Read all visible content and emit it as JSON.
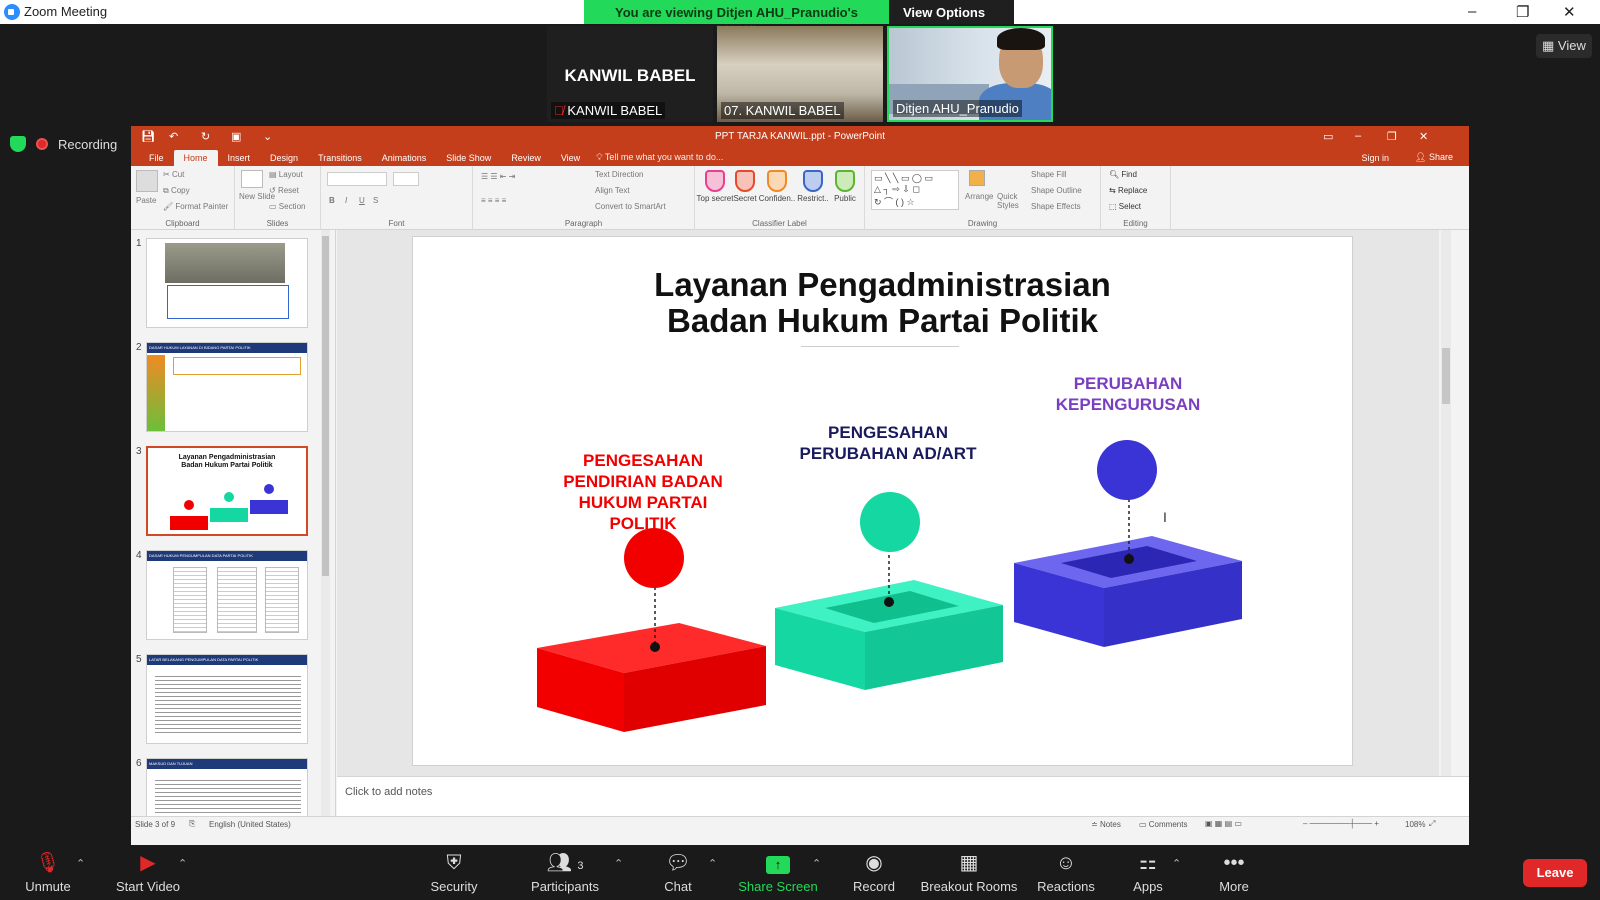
{
  "window": {
    "app_title": "Zoom Meeting",
    "controls": [
      "–",
      "❐",
      "✕"
    ]
  },
  "banner": {
    "viewing_text": "You are viewing Ditjen AHU_Pranudio's screen",
    "options_label": "View Options"
  },
  "view_button": {
    "label": "View"
  },
  "participants": [
    {
      "display_text": "KANWIL BABEL",
      "name": "KANWIL BABEL",
      "muted": true
    },
    {
      "name": "07. KANWIL BABEL"
    },
    {
      "name": "Ditjen AHU_Pranudio",
      "active_speaker": true
    }
  ],
  "recording": {
    "label": "Recording"
  },
  "powerpoint": {
    "window_title": "PPT TARJA KANWIL.ppt - PowerPoint",
    "tabs": [
      "File",
      "Home",
      "Insert",
      "Design",
      "Transitions",
      "Animations",
      "Slide Show",
      "Review",
      "View"
    ],
    "active_tab": "Home",
    "tell_me": "Tell me what you want to do...",
    "sign_in": "Sign in",
    "share": "Share",
    "ribbon": {
      "clipboard": {
        "label": "Clipboard",
        "paste": "Paste",
        "cut": "Cut",
        "copy": "Copy",
        "format_painter": "Format Painter"
      },
      "slides": {
        "label": "Slides",
        "new_slide": "New Slide",
        "layout": "Layout",
        "reset": "Reset",
        "section": "Section"
      },
      "font": {
        "label": "Font"
      },
      "paragraph": {
        "label": "Paragraph",
        "text_direction": "Text Direction",
        "align_text": "Align Text",
        "smartart": "Convert to SmartArt"
      },
      "classifier": {
        "label": "Classifier Label",
        "items": [
          {
            "name": "Top secret",
            "color": "#e8408f"
          },
          {
            "name": "Secret",
            "color": "#e8492d"
          },
          {
            "name": "Confiden..",
            "color": "#f08a24"
          },
          {
            "name": "Restrict..",
            "color": "#3a66c8"
          },
          {
            "name": "Public",
            "color": "#5cb531"
          }
        ]
      },
      "drawing": {
        "label": "Drawing",
        "arrange": "Arrange",
        "quick_styles": "Quick Styles",
        "shape_fill": "Shape Fill",
        "shape_outline": "Shape Outline",
        "shape_effects": "Shape Effects"
      },
      "editing": {
        "label": "Editing",
        "find": "Find",
        "replace": "Replace",
        "select": "Select"
      }
    },
    "thumbnails": [
      {
        "num": "1",
        "title": ""
      },
      {
        "num": "2",
        "title": "DASAR HUKUM LAYANAN DI BIDANG PARTAI POLITIK"
      },
      {
        "num": "3",
        "title": "Layanan Pengadministrasian Badan Hukum Partai Politik"
      },
      {
        "num": "4",
        "title": "DASAR HUKUM PENGUMPULAN DATA PARTAI POLITIK"
      },
      {
        "num": "5",
        "title": "LATAR BELAKANG PENGUMPULAN DATA PARTAI POLITIK"
      },
      {
        "num": "6",
        "title": "MAKSUD DAN TUJUAN"
      }
    ],
    "selected_slide": 3,
    "slide": {
      "title_line1": "Layanan Pengadministrasian",
      "title_line2": "Badan Hukum Partai Politik",
      "items": [
        {
          "label_lines": [
            "PENGESAHAN",
            "PENDIRIAN BADAN",
            "HUKUM PARTAI",
            "POLITIK"
          ],
          "color": "#f20000",
          "dark": "#c10000"
        },
        {
          "label_lines": [
            "PENGESAHAN",
            "PERUBAHAN AD/ART"
          ],
          "color": "#15d7a2",
          "dark": "#0fa37b",
          "label_color": "#1a1a5e"
        },
        {
          "label_lines": [
            "PERUBAHAN",
            "KEPENGURUSAN"
          ],
          "color": "#3a33d6",
          "dark": "#2a24a8",
          "label_color": "#7a3fc0"
        }
      ]
    },
    "notes_placeholder": "Click to add notes",
    "status": {
      "slide_of": "Slide 3 of 9",
      "language": "English (United States)",
      "notes": "Notes",
      "comments": "Comments",
      "zoom": "108%"
    }
  },
  "toolbar": {
    "unmute": "Unmute",
    "start_video": "Start Video",
    "security": "Security",
    "participants": "Participants",
    "participants_count": "3",
    "chat": "Chat",
    "share_screen": "Share Screen",
    "record": "Record",
    "breakout_rooms": "Breakout Rooms",
    "reactions": "Reactions",
    "apps": "Apps",
    "more": "More",
    "leave": "Leave"
  }
}
